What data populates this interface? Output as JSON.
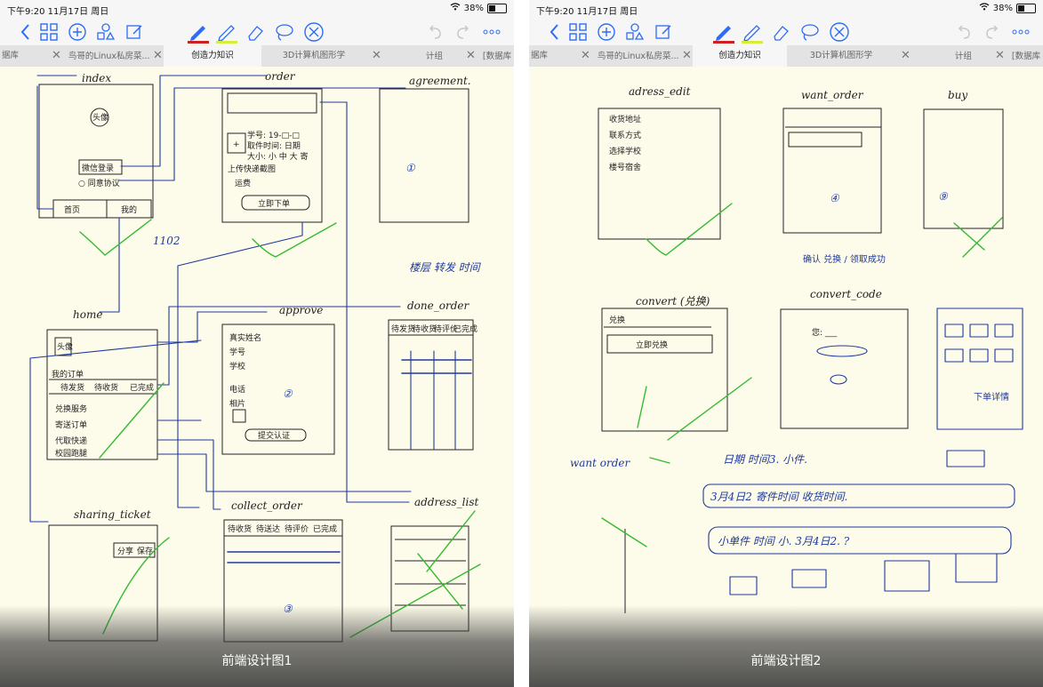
{
  "screens": [
    {
      "status_time": "下午9:20  11月17日 周日",
      "battery": "38%",
      "tabs": [
        "据库",
        "鸟哥的Linux私房菜...",
        "创造力知识",
        "3D计算机图形学",
        "计组",
        "[数据库"
      ],
      "active_tab": 2,
      "caption": "前端设计图1",
      "sketch": {
        "index": "index",
        "order": "order",
        "agreement": "agreement.",
        "home": "home",
        "approve": "approve",
        "done_order": "done_order",
        "sharing_ticket": "sharing_ticket",
        "collect_order": "collect_order",
        "address_list": "address_list",
        "num_1102": "1102",
        "circle_1": "①",
        "circle_2": "②",
        "circle_3": "③",
        "avatar": "头像",
        "login": "微信登录",
        "agree": "○ 同意协议",
        "home_tab": "首页",
        "my_tab": "我的",
        "order_hdr": "我的订单",
        "order_tabs": [
          "待发货",
          "待收货",
          "已完成"
        ],
        "home_menu": [
          "兑换服务",
          "寄送订单",
          "代取快递",
          "校园跑腿"
        ],
        "approve_fields": [
          "真实姓名",
          "学号",
          "学校",
          "电话",
          "相片"
        ],
        "approve_btn": "提交认证",
        "order_form": [
          "学号: 19-□-□",
          "取件时间: 日期",
          "大小: 小 中 大 寄",
          "上传快递截图",
          "运费",
          "立即下单"
        ],
        "done_cols": [
          "待发货",
          "待收货",
          "待评价",
          "已完成"
        ],
        "collect_cols": [
          "待收货",
          "待送达",
          "待评价",
          "已完成"
        ],
        "sharing_btns": [
          "分享",
          "保存"
        ],
        "right_note": "楼层 转发 时间"
      }
    },
    {
      "status_time": "下午9:20  11月17日 周日",
      "battery": "38%",
      "tabs": [
        "据库",
        "鸟哥的Linux私房菜...",
        "创造力知识",
        "3D计算机图形学",
        "计组",
        "[数据库"
      ],
      "active_tab": 2,
      "caption": "前端设计图2",
      "sketch": {
        "adress_edit": "adress_edit",
        "want_order": "want_order",
        "buy": "buy",
        "convert": "convert (兑换)",
        "convert_code": "convert_code",
        "circle_4": "④",
        "circle_9": "⑨",
        "address_fields": [
          "收货地址",
          "联系方式",
          "选择学校",
          "楼号宿舍"
        ],
        "convert_btn": "立即兑换",
        "convert_prefix": "兑换",
        "code_label": "您: ___",
        "mid_note": "确认 兑换 / 领取成功",
        "want_order_note": "want order",
        "date_row": "日期  时间3.  小件.",
        "row1": "3月4日2  寄件时间  收货时间.",
        "row2": "小单件  时间  小.  3月4日2. ?",
        "list_note": "下单详情"
      }
    }
  ]
}
